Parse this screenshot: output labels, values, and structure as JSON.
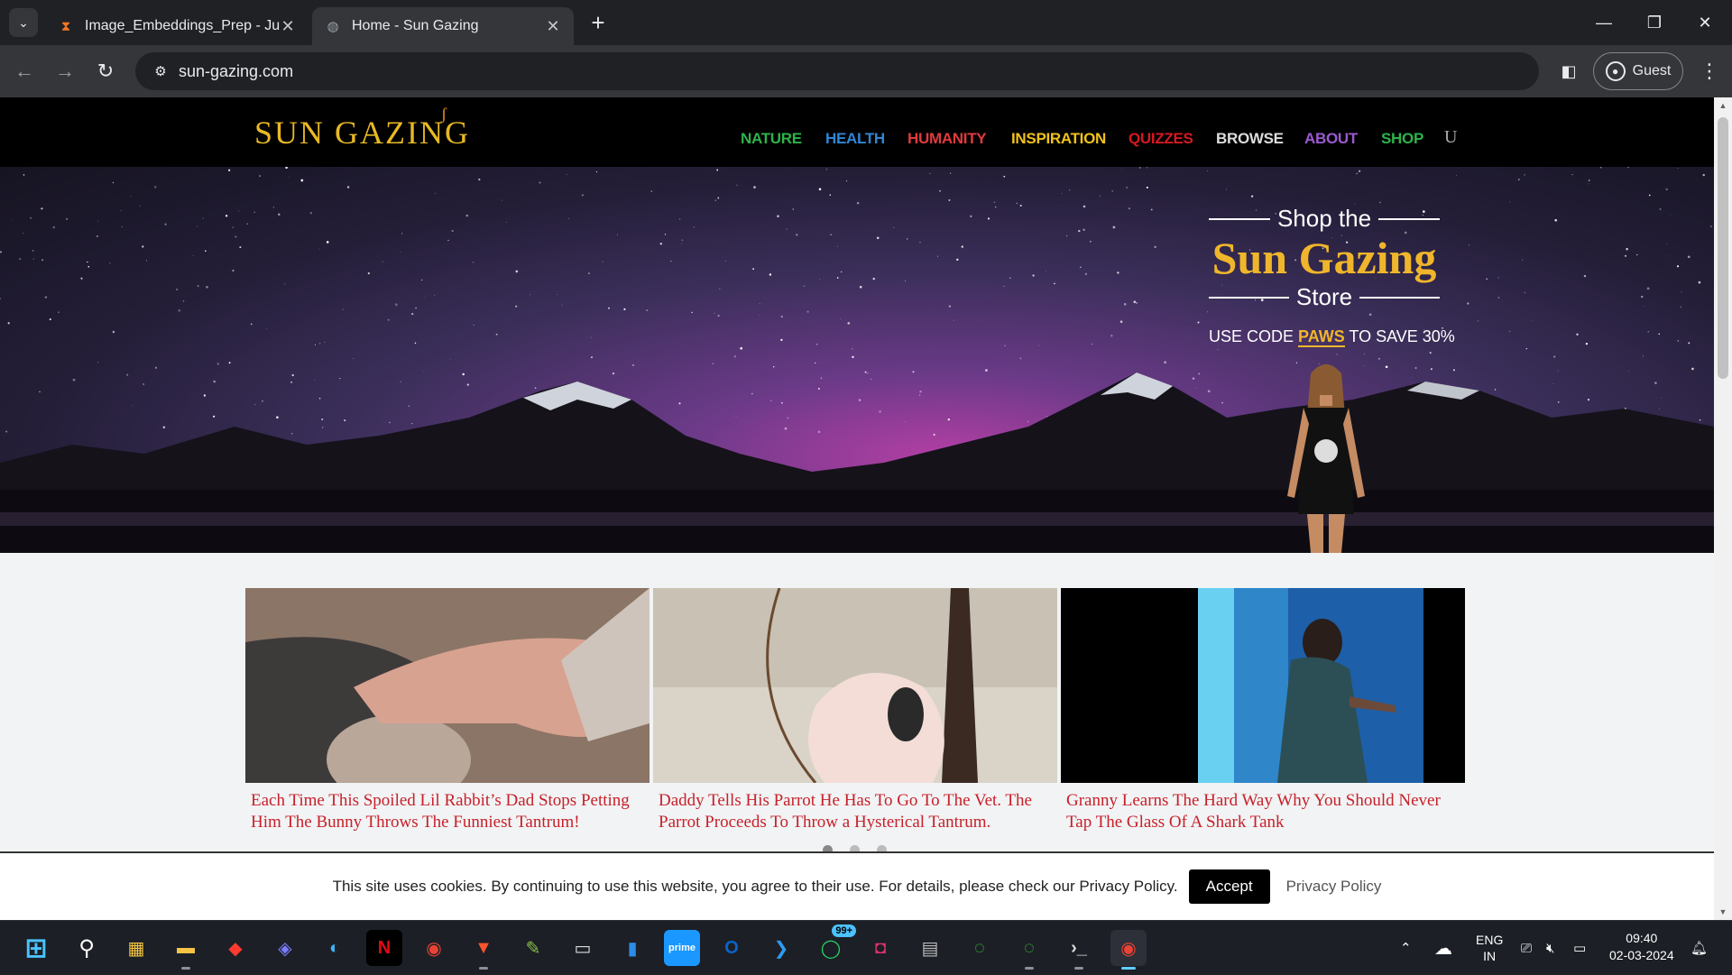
{
  "browser": {
    "tabs": [
      {
        "title": "Image_Embeddings_Prep - Jupy",
        "favicon": "hourglass-icon",
        "active": false
      },
      {
        "title": "Home - Sun Gazing",
        "favicon": "globe-icon",
        "active": true
      }
    ],
    "url": "sun-gazing.com",
    "profile": "Guest"
  },
  "site": {
    "logo": "SUN GAZING",
    "nav": [
      {
        "label": "NATURE",
        "color": "#2db34a"
      },
      {
        "label": "HEALTH",
        "color": "#2f86d6"
      },
      {
        "label": "HUMANITY",
        "color": "#e03a3e"
      },
      {
        "label": "INSPIRATION",
        "color": "#f2c21b"
      },
      {
        "label": "QUIZZES",
        "color": "#d7191f"
      },
      {
        "label": "BROWSE",
        "color": "#dddddd"
      },
      {
        "label": "ABOUT",
        "color": "#9b59d0"
      },
      {
        "label": "SHOP",
        "color": "#2db34a"
      }
    ],
    "nav_extra": "U"
  },
  "hero": {
    "shop_the": "Shop the",
    "brand": "Sun Gazing",
    "store": "Store",
    "code_prefix": "USE CODE",
    "code": "PAWS",
    "code_suffix": "TO SAVE 30%"
  },
  "cards": [
    {
      "caption": "Each Time This Spoiled Lil Rabbit’s Dad Stops Petting Him The Bunny Throws The Funniest Tantrum!"
    },
    {
      "caption": "Daddy Tells His Parrot He Has To Go To The Vet. The Parrot Proceeds To Throw a Hysterical Tantrum."
    },
    {
      "caption": "Granny Learns The Hard Way Why You Should Never Tap The Glass Of A Shark Tank"
    }
  ],
  "cookie": {
    "message": "This site uses cookies. By continuing to use this website, you agree to their use. For details, please check our Privacy Policy.",
    "accept": "Accept",
    "privacy": "Privacy Policy"
  },
  "taskbar": {
    "apps": [
      "start-icon",
      "search-icon",
      "store-icon",
      "file-explorer-icon",
      "app-red-icon",
      "copilot-icon",
      "edge-icon",
      "netflix-icon",
      "chrome-icon",
      "brave-icon",
      "notepad-icon",
      "terminal-icon",
      "app-blue-icon",
      "prime-video-icon",
      "outlook-icon",
      "vscode-icon",
      "whatsapp-icon",
      "instagram-icon",
      "app-window-icon",
      "spinner-icon",
      "spinner-icon-2",
      "terminal-icon-2",
      "chrome-icon-active"
    ],
    "whatsapp_badge": "99+",
    "lang_top": "ENG",
    "lang_bottom": "IN",
    "time": "09:40",
    "date": "02-03-2024"
  }
}
